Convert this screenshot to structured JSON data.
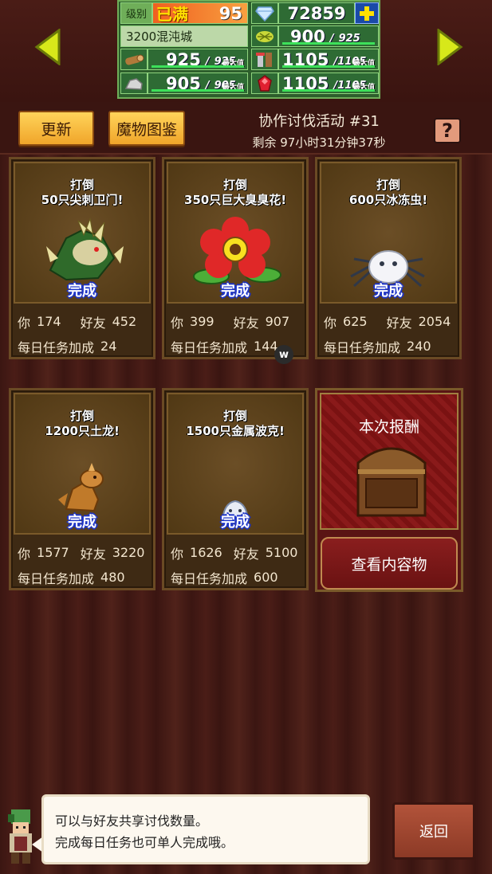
{
  "status": {
    "level_label": "级别",
    "level_status": "已满",
    "level_value": "95",
    "gems": "72859",
    "city": "3200混沌城",
    "food_current": "900",
    "food_max": "925",
    "wood_current": "925",
    "wood_max": "925",
    "tools_current": "1105",
    "tools_max": "1105",
    "stone_current": "905",
    "stone_max": "905",
    "ruby_current": "1105",
    "ruby_max": "1105",
    "max_tag": "最大值",
    "separator": "/"
  },
  "header": {
    "refresh_label": "更新",
    "monster_book_label": "魔物图鉴",
    "event_title": "协作讨伐活动 #31",
    "remaining": "剩余 97小时31分钟37秒",
    "help_label": "?"
  },
  "labels": {
    "you": "你",
    "friends": "好友",
    "daily_bonus": "每日任务加成",
    "done": "完成",
    "defeat": "打倒"
  },
  "cards": [
    {
      "target": "50只尖刺卫门!",
      "you": "174",
      "friends": "452",
      "bonus": "24"
    },
    {
      "target": "350只巨大臭臭花!",
      "you": "399",
      "friends": "907",
      "bonus": "144"
    },
    {
      "target": "600只冰冻虫!",
      "you": "625",
      "friends": "2054",
      "bonus": "240"
    },
    {
      "target": "1200只土龙!",
      "you": "1577",
      "friends": "3220",
      "bonus": "480"
    },
    {
      "target": "1500只金属波克!",
      "you": "1626",
      "friends": "5100",
      "bonus": "600"
    }
  ],
  "reward": {
    "title": "本次报酬",
    "view_button": "查看内容物"
  },
  "badge": "w",
  "footer": {
    "message_line1": "可以与好友共享讨伐数量。",
    "message_line2": "完成每日任务也可单人完成哦。",
    "back_label": "返回"
  }
}
